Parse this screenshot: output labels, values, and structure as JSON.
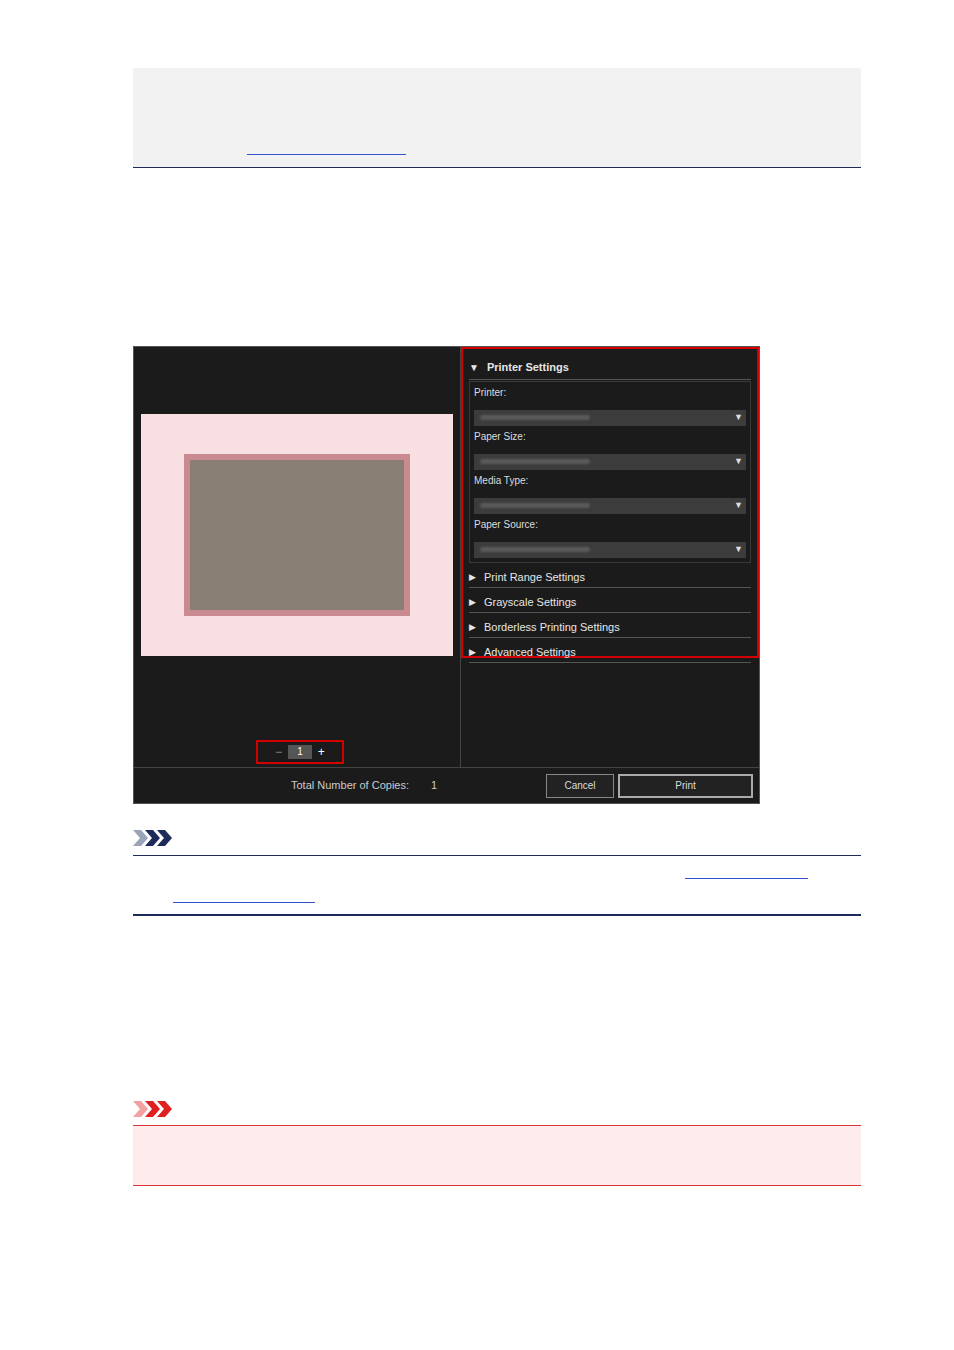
{
  "dialog": {
    "printer_settings": {
      "label": "Printer Settings",
      "expanded": true,
      "toggle": "▼",
      "fields": [
        {
          "label": "Printer:",
          "arrow": "▼"
        },
        {
          "label": "Paper Size:",
          "arrow": "▼"
        },
        {
          "label": "Media Type:",
          "arrow": "▼"
        },
        {
          "label": "Paper Source:",
          "arrow": "▼"
        }
      ]
    },
    "sections": [
      {
        "label": "Print Range Settings",
        "expanded": false,
        "toggle": "▶"
      },
      {
        "label": "Grayscale Settings",
        "expanded": false,
        "toggle": "▶"
      },
      {
        "label": "Borderless Printing Settings",
        "expanded": false,
        "toggle": "▶"
      },
      {
        "label": "Advanced Settings",
        "expanded": false,
        "toggle": "▶"
      }
    ],
    "copies": {
      "minus": "−",
      "value": "1",
      "plus": "+"
    },
    "total": {
      "label": "Total Number of Copies:",
      "value": "1"
    },
    "buttons": [
      {
        "label": "Cancel",
        "selected": false
      },
      {
        "label": "Print",
        "selected": true
      }
    ]
  }
}
